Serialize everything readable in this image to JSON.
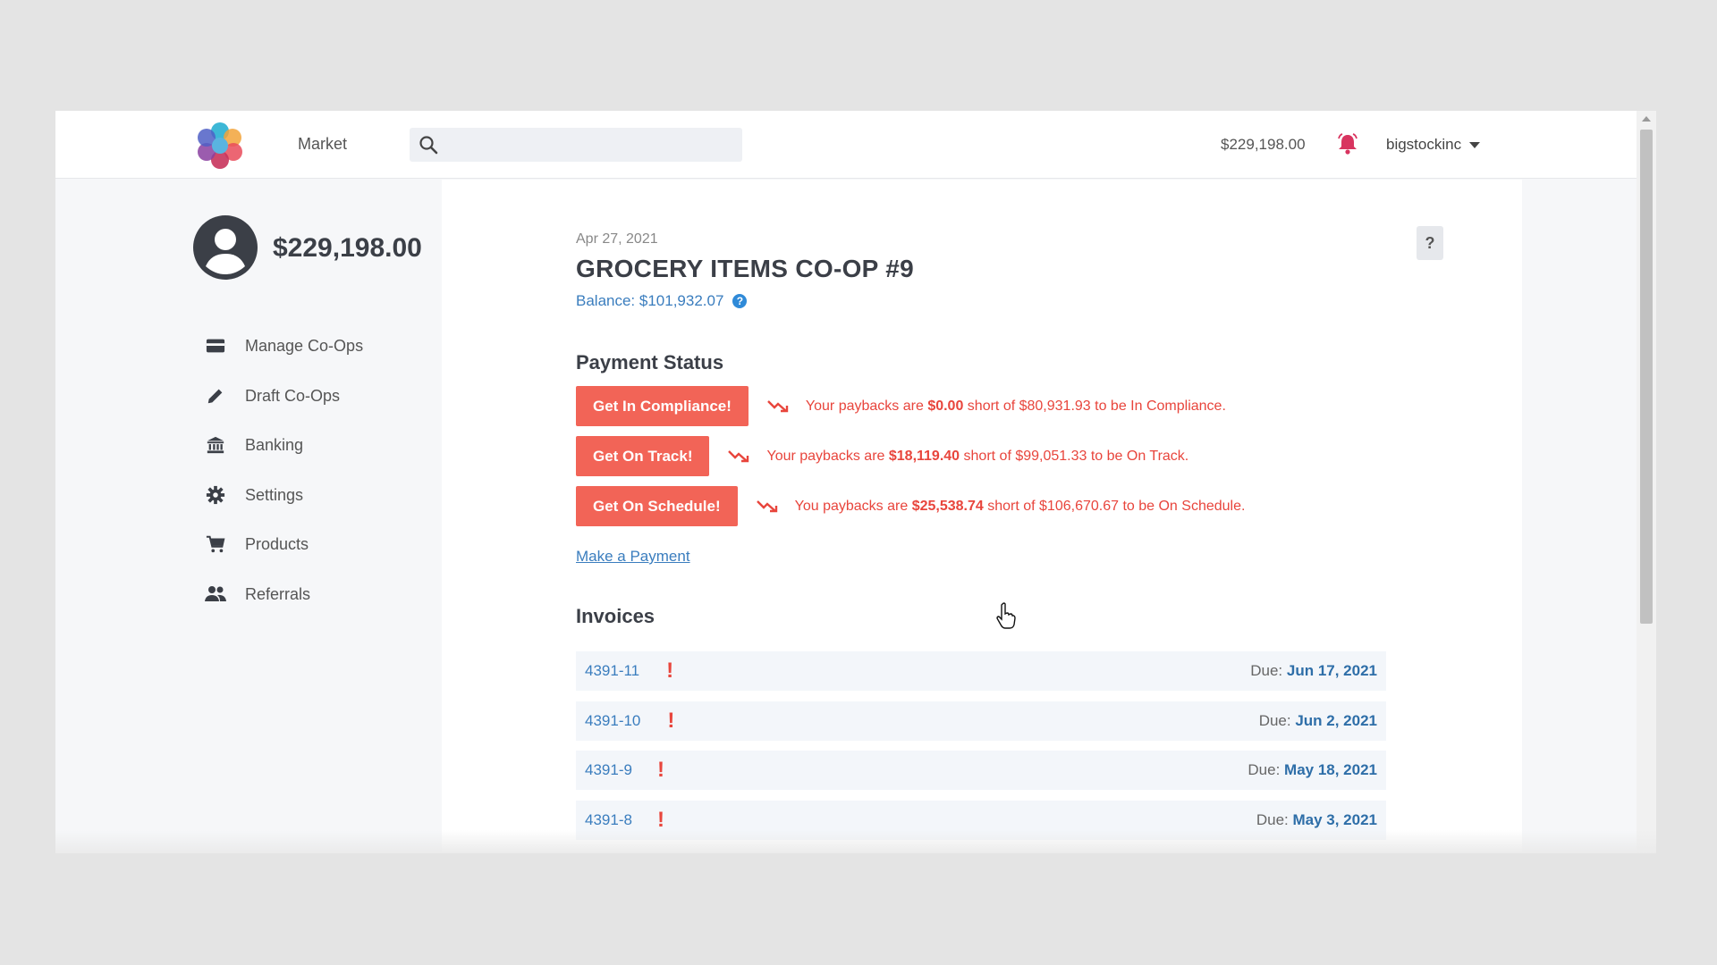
{
  "header": {
    "nav_market": "Market",
    "search_placeholder": "",
    "balance": "$229,198.00",
    "username": "bigstockinc"
  },
  "sidebar": {
    "balance": "$229,198.00",
    "items": [
      {
        "label": "Manage Co-Ops",
        "icon": "card-icon"
      },
      {
        "label": "Draft Co-Ops",
        "icon": "pencil-icon"
      },
      {
        "label": "Banking",
        "icon": "bank-icon"
      },
      {
        "label": "Settings",
        "icon": "gear-icon"
      },
      {
        "label": "Products",
        "icon": "cart-icon"
      },
      {
        "label": "Referrals",
        "icon": "people-icon"
      }
    ]
  },
  "main": {
    "date": "Apr 27, 2021",
    "title": "GROCERY ITEMS CO-OP #9",
    "balance": "Balance: $101,932.07",
    "help_label": "?",
    "payment_status_title": "Payment Status",
    "statuses": [
      {
        "button": "Get In Compliance!",
        "prefix": "Your paybacks are ",
        "amount": "$0.00",
        "suffix": " short of $80,931.93 to be In Compliance."
      },
      {
        "button": "Get On Track!",
        "prefix": "Your paybacks are ",
        "amount": "$18,119.40",
        "suffix": " short of $99,051.33 to be On Track."
      },
      {
        "button": "Get On Schedule!",
        "prefix": "You paybacks are ",
        "amount": "$25,538.74",
        "suffix": " short of $106,670.67 to be On Schedule."
      }
    ],
    "make_payment": "Make a Payment",
    "invoices_title": "Invoices",
    "invoices": [
      {
        "id": "4391-11",
        "alert": "!",
        "due_label": "Due: ",
        "due_date": "Jun 17, 2021"
      },
      {
        "id": "4391-10",
        "alert": "!",
        "due_label": "Due: ",
        "due_date": "Jun 2, 2021"
      },
      {
        "id": "4391-9",
        "alert": "!",
        "due_label": "Due: ",
        "due_date": "May 18, 2021"
      },
      {
        "id": "4391-8",
        "alert": "!",
        "due_label": "Due: ",
        "due_date": "May 3, 2021"
      }
    ]
  },
  "colors": {
    "accent_button": "#f26457",
    "link": "#3a7dbe",
    "alert": "#e8453c",
    "bell": "#d8345f"
  }
}
